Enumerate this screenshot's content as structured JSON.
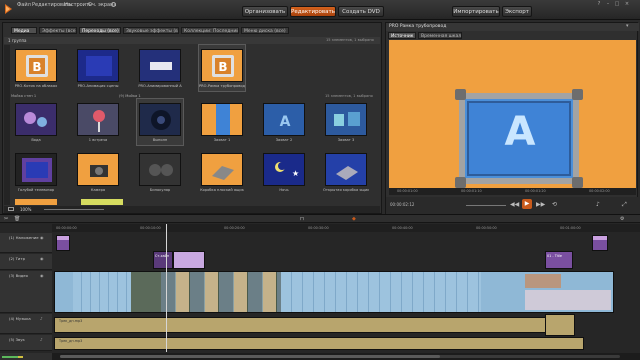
{
  "menu": {
    "items": [
      "Файл",
      "Редактировать",
      "Настроить",
      "Оч. экрана"
    ]
  },
  "modes": {
    "organize": "Организовать",
    "edit": "Редактировать",
    "create_dvd": "Создать DVD",
    "import": "Импортировать",
    "export": "Экспорт"
  },
  "library": {
    "tabs": [
      "Медиа",
      "Эффекты (все)",
      "Переходы (все)",
      "Звуковые эффекты (все)",
      "Коллекции: Последний...",
      "Меню диска (все)"
    ],
    "sub_left": "1 группа",
    "row1_status": "15 элементов, 1 выбрано",
    "row2_group": "Мойка стен 1",
    "row2_center": "(9) Мойка 1",
    "row2_status": "15 элементов, 1 выбрано",
    "row3_status": "(3) элемента",
    "row1": [
      {
        "caption": "PRO-Котик на облаках",
        "style": "orange-b"
      },
      {
        "caption": "PRO-Анимация сцены",
        "style": "blue-dark"
      },
      {
        "caption": "PRO-Анимированный А",
        "style": "blue-car"
      },
      {
        "caption": "PRO-Рамка трубопровод",
        "style": "orange-b"
      }
    ],
    "row2": [
      {
        "caption": "Вода",
        "style": "purple-orbs"
      },
      {
        "caption": "1 встреча",
        "style": "pink-pin"
      },
      {
        "caption": "Выполн",
        "style": "dark-tunnel"
      },
      {
        "caption": "Захват 1",
        "style": "orange-stripe"
      },
      {
        "caption": "Захват 2",
        "style": "blue-a"
      },
      {
        "caption": "Захват 3",
        "style": "teal-blocks"
      }
    ],
    "row3": [
      {
        "caption": "Голубой телевизор",
        "style": "purple-frame"
      },
      {
        "caption": "Камера",
        "style": "orange-camera"
      },
      {
        "caption": "Бинокуляр",
        "style": "dark-binoc"
      },
      {
        "caption": "Коробка плоский ящик",
        "style": "orange-box"
      },
      {
        "caption": "Ночь",
        "style": "blue-night"
      },
      {
        "caption": "Открытая коробка ящика",
        "style": "blue-open-box"
      }
    ],
    "bottom_zoom": "100%"
  },
  "preview": {
    "title": "PRO Рамка трубопровод",
    "tabs": [
      "Источник",
      "Временная шкала"
    ],
    "letter": "A",
    "timecode": "00:00:02:12",
    "ruler": [
      "00:00:01:00",
      "00:00:01:10",
      "00:00:01:20",
      "00:00:02:00"
    ]
  },
  "timeline": {
    "ruler": [
      "00:00:00:00",
      "00:00:10:00",
      "00:00:20:00",
      "00:00:30:00",
      "00:00:40:00",
      "00:00:50:00",
      "00:01:00:00"
    ],
    "tracks": [
      {
        "name": "(1) Наложение"
      },
      {
        "name": "(2) Титр"
      },
      {
        "name": "(3) Видео"
      },
      {
        "name": "(4) Музыка"
      },
      {
        "name": "(5) Звук"
      }
    ],
    "clip_title_a": "Ст-хайп",
    "clip_title_b": "01 - Title",
    "audio_label": "Трек_дп.mp3"
  },
  "colors": {
    "accent": "#c95a1b",
    "orange_bg": "#f0a040",
    "blue_panel": "#3f83d6",
    "audio": "#b8a56d",
    "video": "#8fb8d6"
  }
}
